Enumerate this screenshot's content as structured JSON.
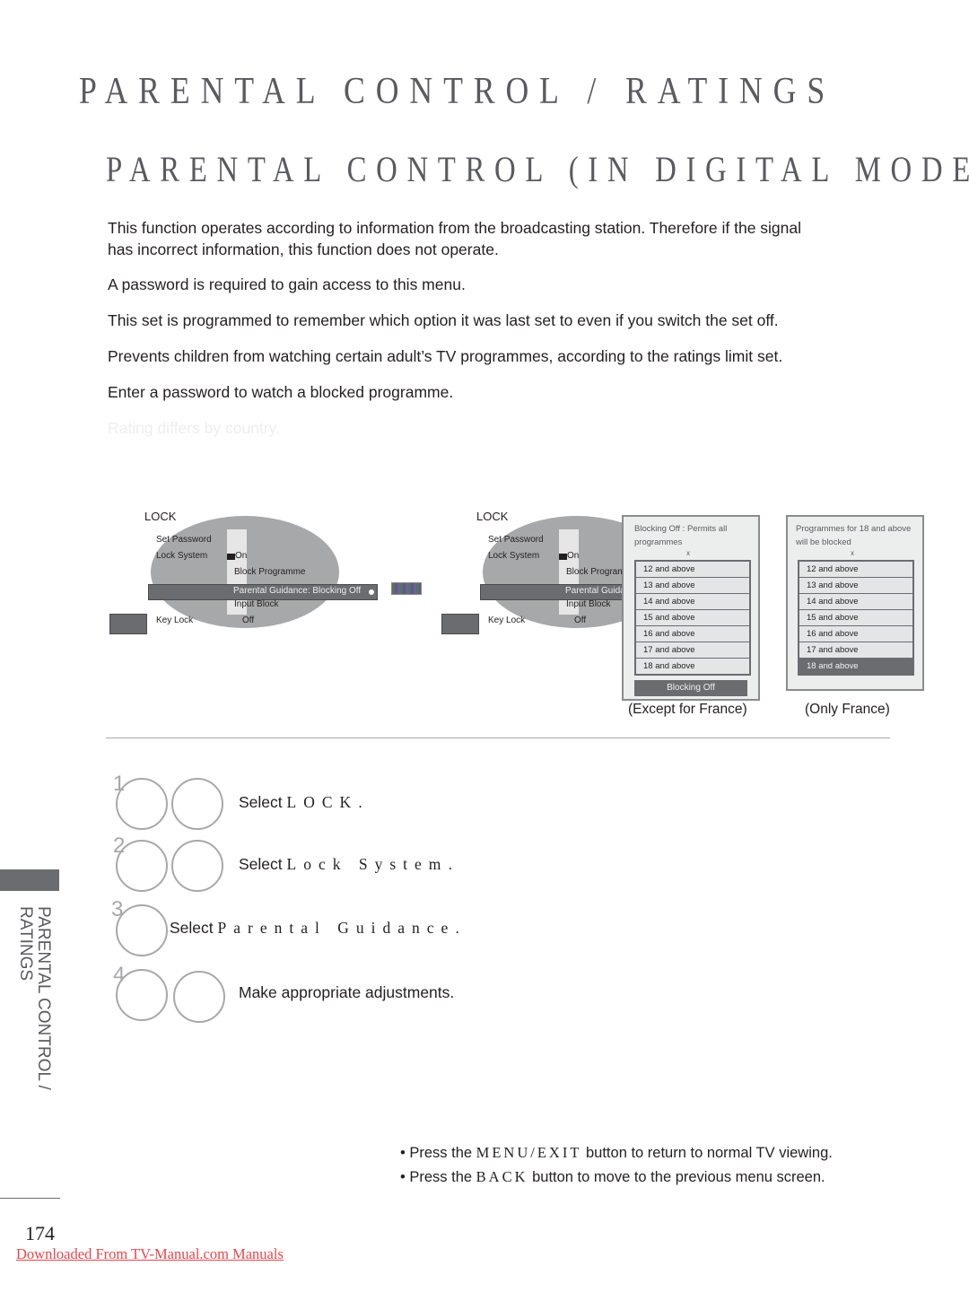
{
  "header": {
    "title": "PARENTAL CONTROL / RATINGS",
    "subtitle": "PARENTAL CONTROL (IN DIGITAL MODE ONLY)"
  },
  "intro": {
    "paragraphs": [
      "This function operates according to information from the broadcasting station. Therefore if the signal",
      "has incorrect information, this function does not operate.",
      "A password is required to gain access to this menu.",
      "This set is programmed to remember which option it was last set to even if you switch the set off.",
      "Prevents children from watching certain adult’s TV programmes, according to the ratings limit set.",
      "Enter a password to watch a blocked programme.",
      "Rating differs by country."
    ]
  },
  "menu_screen": {
    "title": "LOCK",
    "items": {
      "set_password": "Set Password",
      "lock_system": "Lock System",
      "lock_system_value": "On",
      "block_programme": "Block Programme",
      "parental_guidance": "Parental Guidance: Blocking Off",
      "parental_guidance_short": "Parental Guida",
      "block_programme_short": "Block Program",
      "input_block": "Input Block",
      "key_lock": "Key Lock",
      "key_lock_value": "Off"
    }
  },
  "dialog_except_france": {
    "description": "Blocking Off : Permits all programmes",
    "close": "x",
    "options": [
      "12 and above",
      "13 and above",
      "14 and above",
      "15 and above",
      "16 and above",
      "17 and above",
      "18 and above"
    ],
    "selected_button": "Blocking Off",
    "caption": "(Except for France)"
  },
  "dialog_only_france": {
    "description": "Programmes for 18 and above will be blocked",
    "close": "x",
    "options": [
      "12 and above",
      "13 and above",
      "14 and above",
      "15 and above",
      "16 and above",
      "17 and above",
      "18 and above"
    ],
    "selected_index": 6,
    "caption": "(Only France)"
  },
  "steps": [
    {
      "num": "1",
      "prefix": "Select ",
      "target": "LOCK",
      "suffix": "."
    },
    {
      "num": "2",
      "prefix": "Select ",
      "target": "Lock System",
      "suffix": "."
    },
    {
      "num": "3",
      "prefix": "Select ",
      "target": "Parental Guidance",
      "suffix": "."
    },
    {
      "num": "4",
      "text": "Make appropriate adjustments."
    }
  ],
  "side_tab": {
    "line1": "PARENTAL CONTROL /",
    "line2": "RATINGS"
  },
  "notes": [
    {
      "bullet": "•",
      "prefix": "Press the ",
      "button": "MENU/EXIT",
      "suffix": " button to return to normal TV viewing."
    },
    {
      "bullet": "•",
      "prefix": "Press the ",
      "button": "BACK",
      "suffix": " button to move to the previous menu screen."
    }
  ],
  "footer": {
    "page_number": "174",
    "download_link": "Downloaded From TV-Manual.com Manuals"
  }
}
